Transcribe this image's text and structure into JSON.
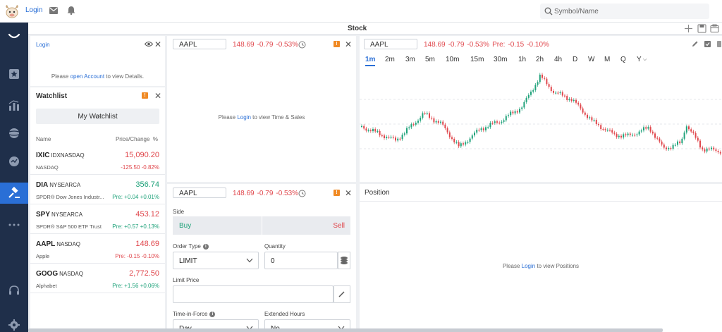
{
  "topbar": {
    "login": "Login",
    "search_placeholder": "Symbol/Name"
  },
  "tabbar": {
    "title": "Stock"
  },
  "nav": {
    "icons": [
      "logo-arc-icon",
      "star-icon",
      "chart-bars-icon",
      "globe-icon",
      "chat-icon",
      "gavel-icon",
      "more-icon",
      "headset-icon",
      "gear-icon"
    ],
    "active_index": 5
  },
  "watchlist_login": {
    "title": "Login",
    "msg_pre": "Please ",
    "msg_link": "open Account",
    "msg_post": " to view Details."
  },
  "watchlist": {
    "title": "Watchlist",
    "badge": "!",
    "selected_list": "My Watchlist",
    "col_name": "Name",
    "col_price": "Price/Change",
    "col_unit": "%",
    "rows": [
      {
        "symbol": "IXIC",
        "exchange": "IDXNASDAQ",
        "price": "15,090.20",
        "name": "NASDAQ",
        "change": "-125.50",
        "pct": "-0.82%",
        "prefix": "",
        "color": "#e0474c",
        "price_color": "#e0474c"
      },
      {
        "symbol": "DIA",
        "exchange": "NYSEARCA",
        "price": "356.74",
        "name": "SPDR® Dow Jones Industr...",
        "change": "+0.04",
        "pct": "+0.01%",
        "prefix": "Pre: ",
        "color": "#1fa27a",
        "price_color": "#1fa27a"
      },
      {
        "symbol": "SPY",
        "exchange": "NYSEARCA",
        "price": "453.12",
        "name": "SPDR® S&P 500 ETF Trust",
        "change": "+0.57",
        "pct": "+0.13%",
        "prefix": "Pre: ",
        "color": "#1fa27a",
        "price_color": "#e0474c"
      },
      {
        "symbol": "AAPL",
        "exchange": "NASDAQ",
        "price": "148.69",
        "name": "Apple",
        "change": "-0.15",
        "pct": "-0.10%",
        "prefix": "Pre: ",
        "color": "#e0474c",
        "price_color": "#e0474c"
      },
      {
        "symbol": "GOOG",
        "exchange": "NASDAQ",
        "price": "2,772.50",
        "name": "Alphabet",
        "change": "+1.56",
        "pct": "+0.06%",
        "prefix": "Pre: ",
        "color": "#1fa27a",
        "price_color": "#e0474c"
      }
    ]
  },
  "timesales": {
    "symbol": "AAPL",
    "price": "148.69",
    "change": "-0.79",
    "pct": "-0.53%",
    "badge": "!",
    "msg_pre": "Please ",
    "msg_link": "Login",
    "msg_post": " to view Time & Sales"
  },
  "chart": {
    "symbol": "AAPL",
    "price": "148.69",
    "change": "-0.79",
    "pct": "-0.53%",
    "pre_label": "Pre:",
    "pre_change": "-0.15",
    "pre_pct": "-0.10%",
    "timeframes": [
      "1m",
      "2m",
      "3m",
      "5m",
      "10m",
      "15m",
      "30m",
      "1h",
      "2h",
      "4h",
      "D",
      "W",
      "M",
      "Q",
      "Y"
    ],
    "active_timeframe": "1m",
    "up_color": "#1fa27a",
    "down_color": "#e0474c"
  },
  "order": {
    "symbol": "AAPL",
    "price": "148.69",
    "change": "-0.79",
    "pct": "-0.53%",
    "badge": "!",
    "side_label": "Side",
    "buy": "Buy",
    "sell": "Sell",
    "order_type_label": "Order Type",
    "order_type": "LIMIT",
    "quantity_label": "Quantity",
    "quantity": "0",
    "limit_price_label": "Limit Price",
    "tif_label": "Time-in-Force",
    "tif": "Day",
    "ext_label": "Extended Hours",
    "ext": "No"
  },
  "position": {
    "title": "Position",
    "msg_pre": "Please ",
    "msg_link": "Login",
    "msg_post": " to view Positions"
  }
}
